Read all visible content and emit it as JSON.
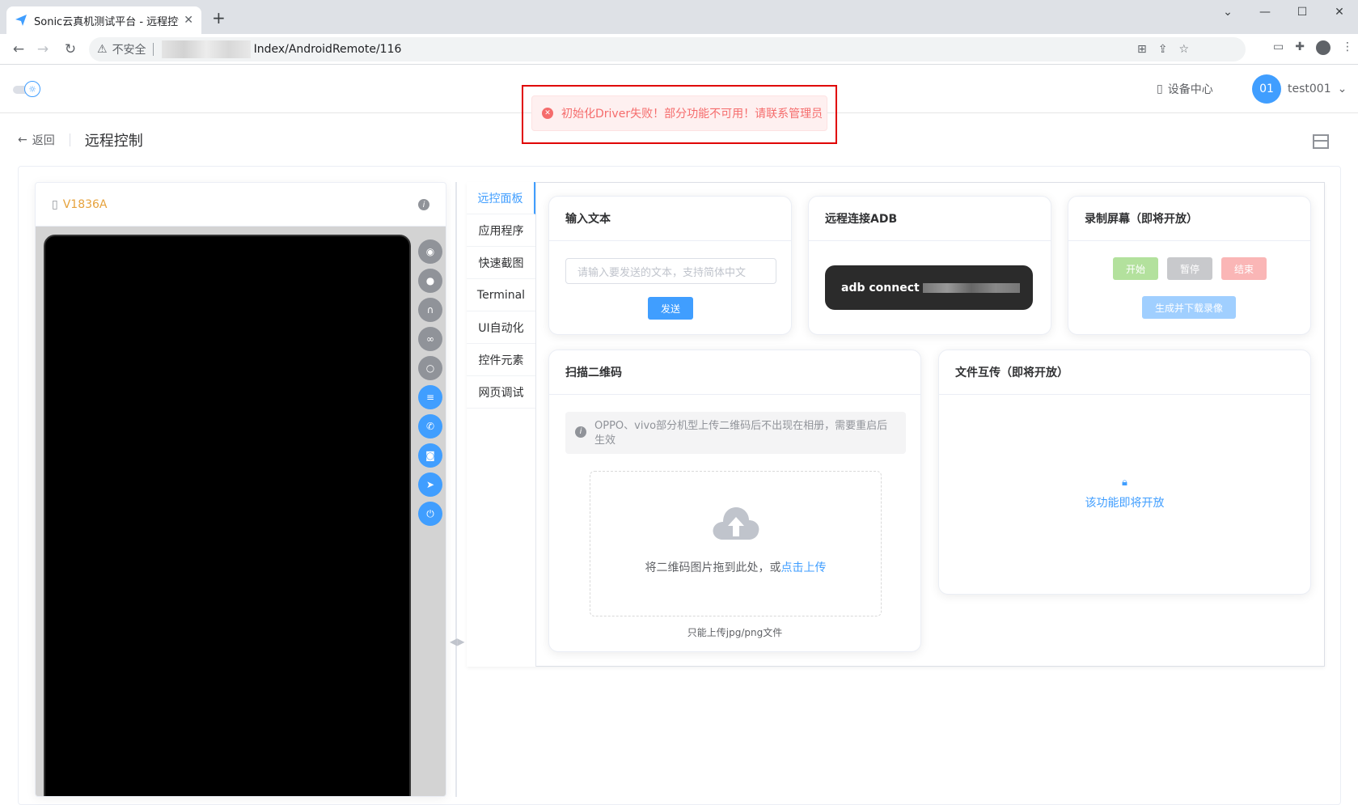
{
  "browser": {
    "tab_title": "Sonic云真机测试平台 - 远程控制",
    "tab_close": "✕",
    "new_tab": "+",
    "insecure_label": "不安全",
    "url_path": "Index/AndroidRemote/116"
  },
  "header": {
    "device_center": "设备中心",
    "avatar_text": "01",
    "username": "test001"
  },
  "toast": {
    "message": "初始化Driver失败！部分功能不可用！请联系管理员"
  },
  "page": {
    "back_label": "返回",
    "title": "远程控制"
  },
  "device": {
    "name": "V1836A"
  },
  "tabs": [
    {
      "label": "远控面板"
    },
    {
      "label": "应用程序"
    },
    {
      "label": "快速截图"
    },
    {
      "label": "Terminal"
    },
    {
      "label": "UI自动化"
    },
    {
      "label": "控件元素"
    },
    {
      "label": "网页调试"
    }
  ],
  "input_text_card": {
    "title": "输入文本",
    "placeholder": "请输入要发送的文本，支持简体中文",
    "send_label": "发送"
  },
  "adb_card": {
    "title": "远程连接ADB",
    "command": "adb connect"
  },
  "record_card": {
    "title": "录制屏幕（即将开放）",
    "start_label": "开始",
    "pause_label": "暂停",
    "stop_label": "结束",
    "download_label": "生成并下载录像"
  },
  "qr_card": {
    "title": "扫描二维码",
    "notice": "OPPO、vivo部分机型上传二维码后不出现在相册，需要重启后生效",
    "drop_text": "将二维码图片拖到此处，或",
    "click_upload": "点击上传",
    "tip": "只能上传jpg/png文件"
  },
  "file_card": {
    "title": "文件互传（即将开放）",
    "coming_soon": "该功能即将开放"
  },
  "colors": {
    "primary": "#409eff",
    "danger": "#f56c6c",
    "warning": "#e6a23c",
    "success": "#67c23a"
  }
}
